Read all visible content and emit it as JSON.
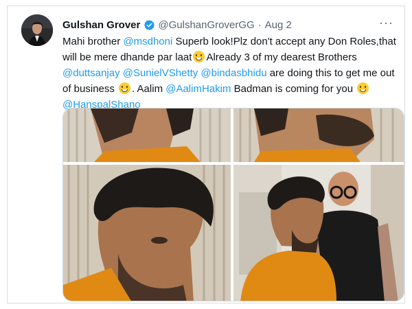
{
  "tweet": {
    "author_name": "Gulshan Grover",
    "handle": "@GulshanGroverGG",
    "separator": "·",
    "date": "Aug 2",
    "more_label": "···",
    "segments": [
      {
        "t": "Mahi brother ",
        "mention": false
      },
      {
        "t": "@msdhoni",
        "mention": true
      },
      {
        "t": " Superb look!Plz don't accept any Don Roles,that will be mere dhande par laat",
        "mention": false
      },
      {
        "t": "Already 3 of my dearest Brothers ",
        "mention": false
      },
      {
        "t": "@duttsanjay",
        "mention": true
      },
      {
        "t": " ",
        "mention": false
      },
      {
        "t": "@SunielVShetty",
        "mention": true
      },
      {
        "t": " ",
        "mention": false
      },
      {
        "t": "@bindasbhidu",
        "mention": true
      },
      {
        "t": " are doing this to get me out of business ",
        "mention": false
      },
      {
        "t": ". Aalim ",
        "mention": false
      },
      {
        "t": "@AalimHakim",
        "mention": true
      },
      {
        "t": " Badman is coming for you ",
        "mention": false
      },
      {
        "t": "@HanspalShano",
        "mention": true
      }
    ],
    "icons": {
      "verified": "verified-badge-icon",
      "emoji": "grinning-face-emoji",
      "more": "more-options-icon"
    },
    "colors": {
      "mention": "#1d9bf0",
      "verified": "#1d9bf0",
      "text": "#0f1419",
      "secondary": "#536471"
    },
    "media_count": 4
  }
}
